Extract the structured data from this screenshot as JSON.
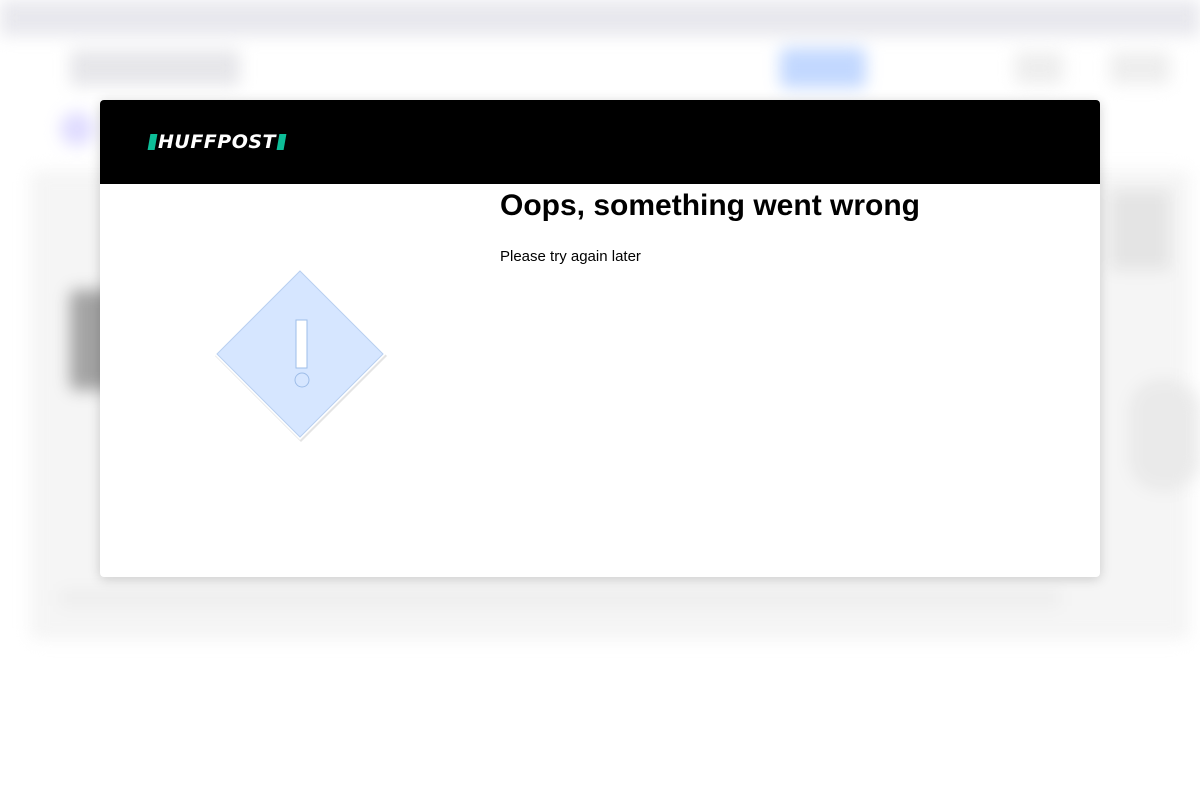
{
  "modal": {
    "brand": {
      "logo_text": "HUFFPOST",
      "accent_color": "#0dbe98",
      "header_color": "#000000"
    },
    "error": {
      "title": "Oops, something went wrong",
      "message": "Please try again later",
      "icon": "warning-diamond-icon",
      "icon_fill": "#d6e6ff"
    }
  }
}
